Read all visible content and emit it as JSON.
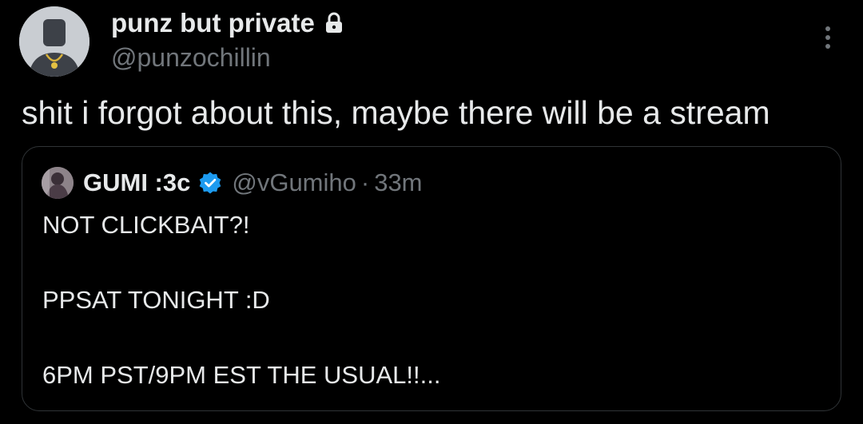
{
  "tweet": {
    "author": {
      "name": "punz but private",
      "handle": "@punzochillin",
      "locked": true
    },
    "text": "shit i forgot about this, maybe there will be a stream",
    "menu_icon": "more-vertical-icon"
  },
  "quote": {
    "author": {
      "name": "GUMI :3c",
      "handle": "@vGumiho",
      "verified": true
    },
    "separator": "·",
    "time": "33m",
    "lines": [
      "NOT CLICKBAIT?!",
      "PPSAT TONIGHT :D",
      "6PM PST/9PM EST THE USUAL!!..."
    ]
  },
  "colors": {
    "background": "#000000",
    "text_primary": "#e7e9ea",
    "text_secondary": "#71767b",
    "border": "#2f3336",
    "verified_blue": "#1d9bf0"
  }
}
